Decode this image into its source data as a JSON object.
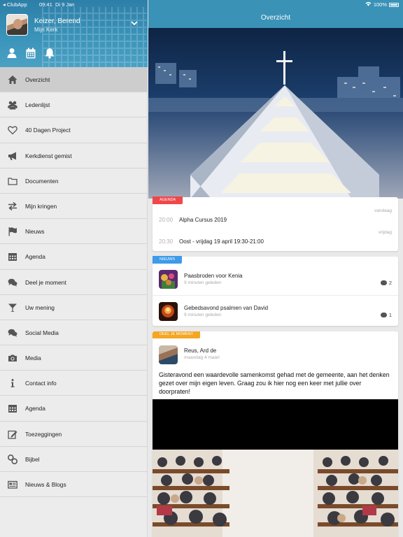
{
  "status_bar": {
    "carrier": "◂ ClubApp",
    "time": "09:41",
    "date": "Di 9 Jan",
    "battery": "100%"
  },
  "sidebar": {
    "user_name": "Keizer, Berend",
    "church": "Mijn Kerk",
    "quick_icons": [
      "user-icon",
      "calendar-icon",
      "bell-icon"
    ],
    "items": [
      {
        "label": "Overzicht",
        "icon": "home-icon",
        "active": true
      },
      {
        "label": "Ledenlijst",
        "icon": "people-icon"
      },
      {
        "label": "40 Dagen Project",
        "icon": "heart-icon"
      },
      {
        "label": "Kerkdienst gemist",
        "icon": "megaphone-icon"
      },
      {
        "label": "Documenten",
        "icon": "folder-icon"
      },
      {
        "label": "Mijn kringen",
        "icon": "exchange-icon"
      },
      {
        "label": "Nieuws",
        "icon": "flag-icon"
      },
      {
        "label": "Agenda",
        "icon": "calendar-icon"
      },
      {
        "label": "Deel je moment",
        "icon": "chat-icon"
      },
      {
        "label": "Uw mening",
        "icon": "cocktail-icon"
      },
      {
        "label": "Social Media",
        "icon": "chat-icon"
      },
      {
        "label": "Media",
        "icon": "camera-icon"
      },
      {
        "label": "Contact info",
        "icon": "info-icon"
      },
      {
        "label": "Agenda",
        "icon": "calendar-icon"
      },
      {
        "label": "Toezeggingen",
        "icon": "edit-icon"
      },
      {
        "label": "Bijbel",
        "icon": "link-icon"
      },
      {
        "label": "Nieuws & Blogs",
        "icon": "newspaper-icon"
      }
    ]
  },
  "main": {
    "title": "Overzicht",
    "agenda": {
      "tag": "AGENDA",
      "tag_color": "#f0474a",
      "rows": [
        {
          "day": "vandaag",
          "time": "20:00",
          "title": "Alpha Cursus 2019"
        },
        {
          "day": "vrijdag",
          "time": "20:30",
          "title": "Oost - vrijdag 19 april 19:30-21:00"
        }
      ]
    },
    "news": {
      "tag": "NIEUWS",
      "tag_color": "#3d9be9",
      "rows": [
        {
          "title": "Paasbroden voor Kenia",
          "time": "9 minuten geleden",
          "comments": "2"
        },
        {
          "title": "Gebedsavond psalmen van David",
          "time": "9 minuten geleden",
          "comments": "1"
        }
      ]
    },
    "moment": {
      "tag": "DEEL JE MOMENT",
      "tag_color": "#f5a623",
      "author": "Reus, Ard de",
      "date": "maandag 4 maart",
      "text": "Gisteravond een waardevolle samenkomst gehad met de gemeente, aan het denken gezet over mijn eigen leven. Graag zou ik hier nog een keer met jullie over doorpraten!"
    }
  }
}
